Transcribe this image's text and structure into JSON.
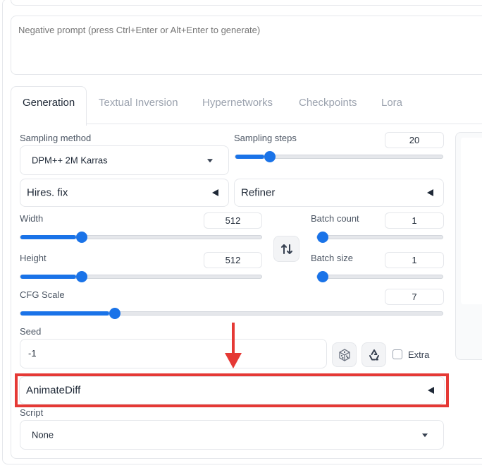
{
  "prompt": {
    "negative_placeholder": "Negative prompt (press Ctrl+Enter or Alt+Enter to generate)"
  },
  "tabs": [
    {
      "label": "Generation",
      "active": true
    },
    {
      "label": "Textual Inversion",
      "active": false
    },
    {
      "label": "Hypernetworks",
      "active": false
    },
    {
      "label": "Checkpoints",
      "active": false
    },
    {
      "label": "Lora",
      "active": false
    }
  ],
  "generation": {
    "sampling_method": {
      "label": "Sampling method",
      "value": "DPM++ 2M Karras"
    },
    "sampling_steps": {
      "label": "Sampling steps",
      "value": "20",
      "fraction": 0.14
    },
    "hires_fix": {
      "label": "Hires. fix"
    },
    "refiner": {
      "label": "Refiner"
    },
    "width": {
      "label": "Width",
      "value": "512",
      "fraction": 0.23
    },
    "height": {
      "label": "Height",
      "value": "512",
      "fraction": 0.23
    },
    "batch_count": {
      "label": "Batch count",
      "value": "1",
      "fraction": 0.0
    },
    "batch_size": {
      "label": "Batch size",
      "value": "1",
      "fraction": 0.0
    },
    "cfg_scale": {
      "label": "CFG Scale",
      "value": "7",
      "fraction": 0.21
    },
    "seed": {
      "label": "Seed",
      "value": "-1",
      "extra_label": "Extra"
    },
    "animatediff": {
      "label": "AnimateDiff"
    },
    "script": {
      "label": "Script",
      "value": "None"
    }
  },
  "icons": {
    "swap": "swap-arrows-icon",
    "dice": "dice-icon",
    "recycle": "recycle-icon"
  },
  "colors": {
    "accent": "#1a73e8",
    "highlight": "#e53935"
  }
}
